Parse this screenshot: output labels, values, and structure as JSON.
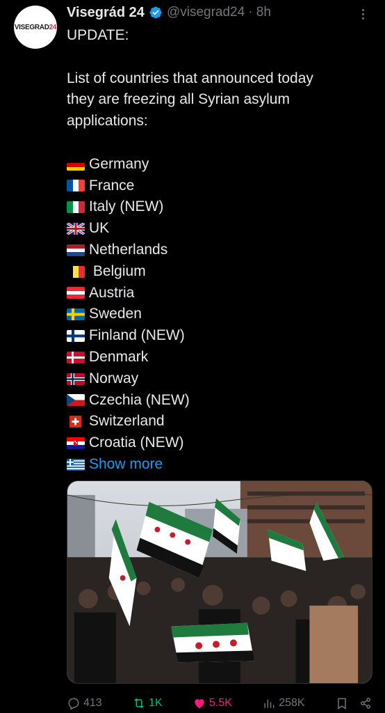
{
  "author": {
    "name": "Visegrád 24",
    "handle": "@visegrad24",
    "time": "· 8h",
    "avatar_text": "VISEGRAD",
    "avatar_num": "24",
    "verified_icon": "verified-badge-icon"
  },
  "tweet": {
    "heading": "UPDATE:",
    "intro_lines": [
      "List of countries that announced today",
      "they are freezing all Syrian asylum",
      "applications:"
    ],
    "countries": [
      {
        "flag": "de",
        "label": "Germany"
      },
      {
        "flag": "fr",
        "label": "France"
      },
      {
        "flag": "it",
        "label": "Italy (NEW)"
      },
      {
        "flag": "uk",
        "label": "UK"
      },
      {
        "flag": "nl",
        "label": "Netherlands"
      },
      {
        "flag": "be",
        "label": " Belgium"
      },
      {
        "flag": "at",
        "label": "Austria"
      },
      {
        "flag": "se",
        "label": "Sweden"
      },
      {
        "flag": "fi",
        "label": "Finland (NEW)"
      },
      {
        "flag": "dk",
        "label": "Denmark"
      },
      {
        "flag": "no",
        "label": "Norway"
      },
      {
        "flag": "cz",
        "label": "Czechia (NEW)"
      },
      {
        "flag": "ch",
        "label": "Switzerland"
      },
      {
        "flag": "hr",
        "label": "Croatia (NEW)"
      }
    ],
    "show_more": {
      "flag": "gr",
      "label": "Show more"
    }
  },
  "actions": {
    "replies": "413",
    "reposts": "1K",
    "likes": "5.5K",
    "views": "258K"
  },
  "colors": {
    "background": "#000000",
    "text": "#e7e9ea",
    "muted": "#71767b",
    "link": "#1d9bf0",
    "repost": "#00ba7c",
    "like": "#f91880"
  }
}
